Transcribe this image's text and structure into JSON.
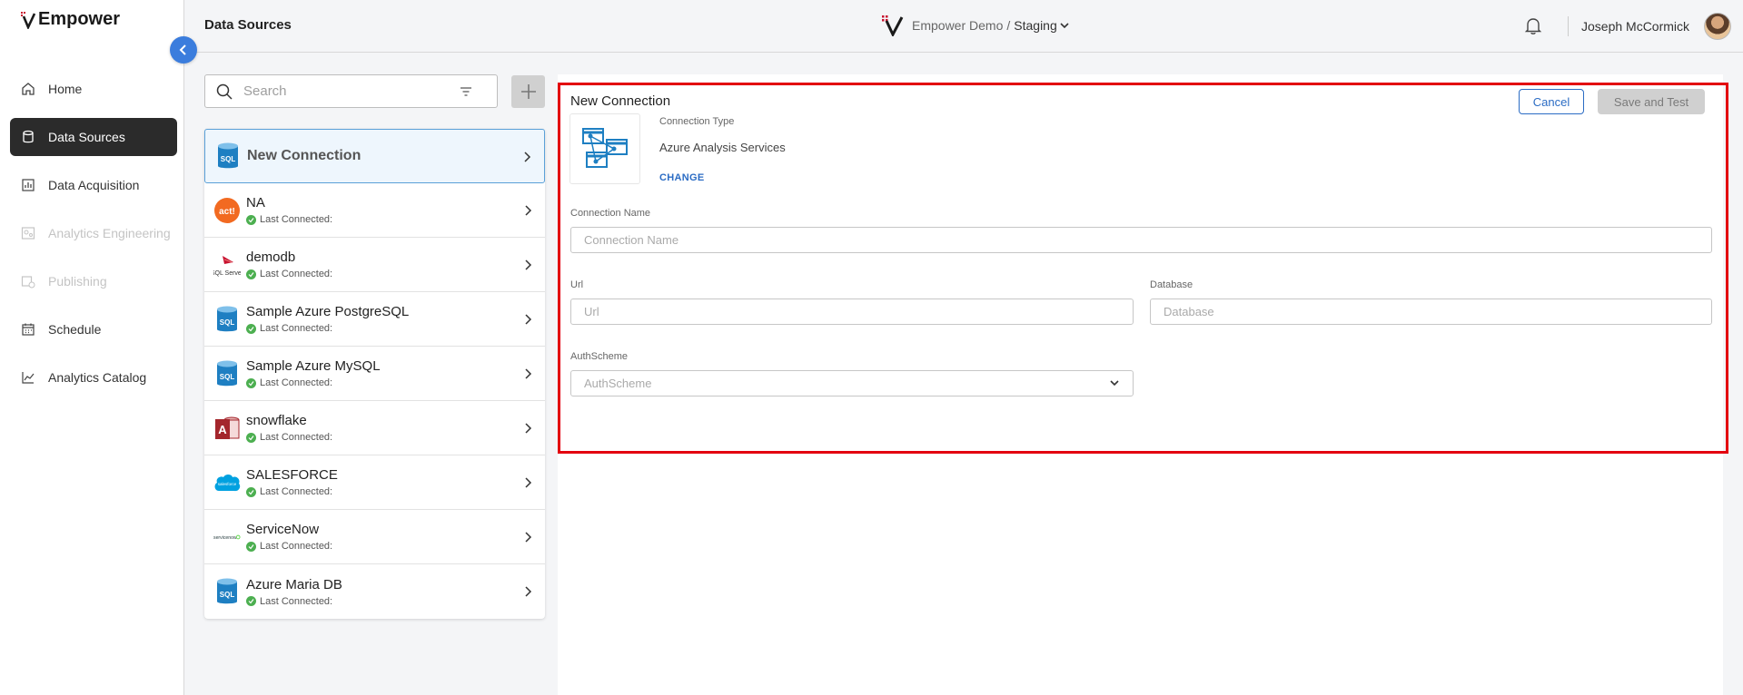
{
  "app": {
    "logo_text": "Empower",
    "page_title": "Data Sources",
    "env_name": "Empower Demo",
    "env_separator": "/",
    "env_stage": "Staging",
    "user_name": "Joseph McCormick"
  },
  "sidebar": {
    "items": [
      {
        "label": "Home",
        "icon": "home-icon",
        "state": "normal"
      },
      {
        "label": "Data Sources",
        "icon": "database-icon",
        "state": "active"
      },
      {
        "label": "Data Acquisition",
        "icon": "bar-chart-icon",
        "state": "normal"
      },
      {
        "label": "Analytics Engineering",
        "icon": "engineering-icon",
        "state": "disabled"
      },
      {
        "label": "Publishing",
        "icon": "publish-icon",
        "state": "disabled"
      },
      {
        "label": "Schedule",
        "icon": "calendar-icon",
        "state": "normal"
      },
      {
        "label": "Analytics Catalog",
        "icon": "line-chart-icon",
        "state": "normal"
      }
    ]
  },
  "search": {
    "placeholder": "Search"
  },
  "connections": {
    "status_label": "Last Connected:",
    "items": [
      {
        "name": "New Connection",
        "icon": "sql-db-icon",
        "selected": true
      },
      {
        "name": "NA",
        "icon": "act-logo-icon"
      },
      {
        "name": "demodb",
        "icon": "sql-server-logo-icon"
      },
      {
        "name": "Sample Azure PostgreSQL",
        "icon": "sql-db-icon"
      },
      {
        "name": "Sample Azure MySQL",
        "icon": "sql-db-icon"
      },
      {
        "name": "snowflake",
        "icon": "access-db-icon"
      },
      {
        "name": "SALESFORCE",
        "icon": "salesforce-logo-icon"
      },
      {
        "name": "ServiceNow",
        "icon": "servicenow-logo-icon"
      },
      {
        "name": "Azure Maria DB",
        "icon": "sql-db-icon"
      }
    ]
  },
  "form": {
    "title": "New Connection",
    "cancel_label": "Cancel",
    "save_label": "Save and Test",
    "connection_type_label": "Connection Type",
    "connection_type_value": "Azure Analysis Services",
    "change_label": "CHANGE",
    "connection_name_label": "Connection Name",
    "connection_name_placeholder": "Connection Name",
    "url_label": "Url",
    "url_placeholder": "Url",
    "database_label": "Database",
    "database_placeholder": "Database",
    "authscheme_label": "AuthScheme",
    "authscheme_placeholder": "AuthScheme"
  },
  "colors": {
    "accent_blue": "#2b6cc4",
    "highlight_red": "#e3000f",
    "active_nav": "#2b2b2b",
    "status_green": "#4caf50"
  }
}
